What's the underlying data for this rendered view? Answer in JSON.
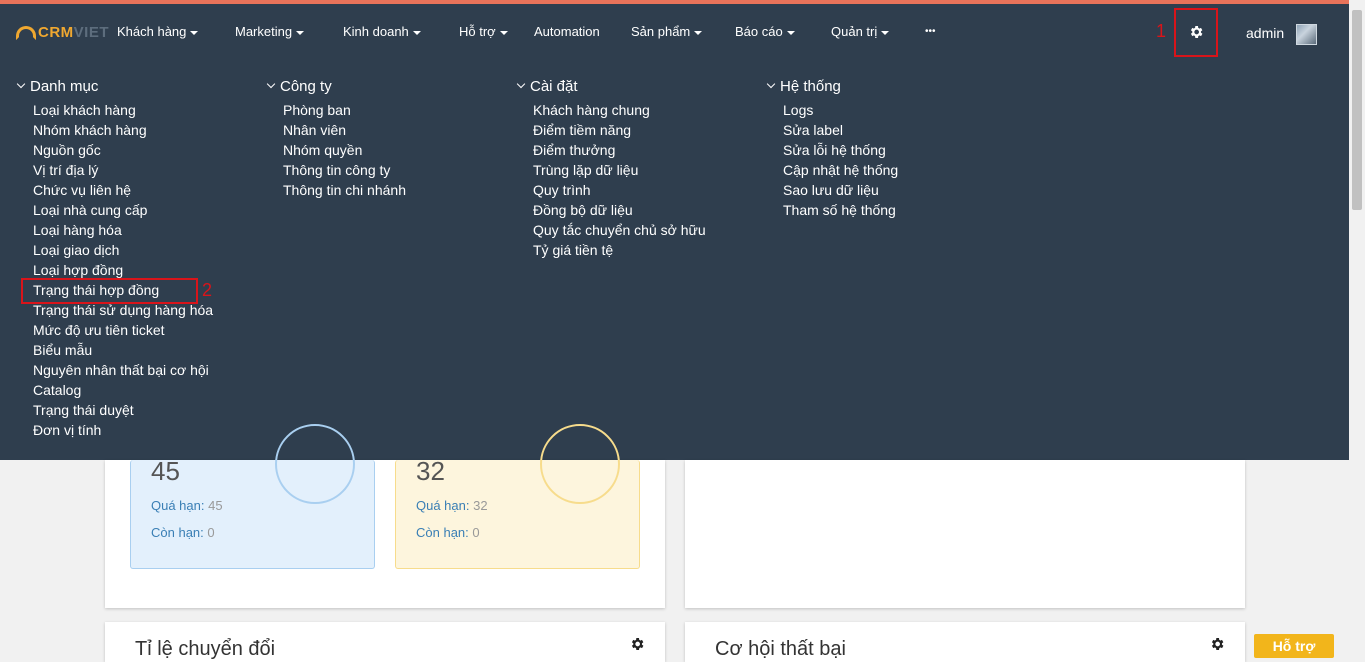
{
  "app": {
    "logo_main": "CRM",
    "logo_sub": "VIET"
  },
  "nav": {
    "items": [
      {
        "label": "Khách hàng",
        "caret": true
      },
      {
        "label": "Marketing",
        "caret": true
      },
      {
        "label": "Kinh doanh",
        "caret": true
      },
      {
        "label": "Hỗ trợ",
        "caret": true
      },
      {
        "label": "Automation",
        "caret": false
      },
      {
        "label": "Sản phẩm",
        "caret": true
      },
      {
        "label": "Báo cáo",
        "caret": true
      },
      {
        "label": "Quản trị",
        "caret": true
      },
      {
        "label": "•••",
        "caret": false
      }
    ],
    "settings_icon": "gear-icon",
    "user": "admin"
  },
  "annotations": {
    "step1": "1",
    "step2": "2"
  },
  "menu": {
    "columns": [
      {
        "title": "Danh mục",
        "items": [
          "Loại khách hàng",
          "Nhóm khách hàng",
          "Nguồn gốc",
          "Vị trí địa lý",
          "Chức vụ liên hệ",
          "Loại nhà cung cấp",
          "Loại hàng hóa",
          "Loại giao dịch",
          "Loại hợp đồng",
          "Trạng thái hợp đồng",
          "Trạng thái sử dụng hàng hóa",
          "Mức độ ưu tiên ticket",
          "Biểu mẫu",
          "Nguyên nhân thất bại cơ hội",
          "Catalog",
          "Trạng thái duyệt",
          "Đơn vị tính"
        ]
      },
      {
        "title": "Công ty",
        "items": [
          "Phòng ban",
          "Nhân viên",
          "Nhóm quyền",
          "Thông tin công ty",
          "Thông tin chi nhánh"
        ]
      },
      {
        "title": "Cài đặt",
        "items": [
          "Khách hàng chung",
          "Điểm tiềm năng",
          "Điểm thưởng",
          "Trùng lặp dữ liệu",
          "Quy trình",
          "Đồng bộ dữ liệu",
          "Quy tắc chuyển chủ sở hữu",
          "Tỷ giá tiền tệ"
        ]
      },
      {
        "title": "Hệ thống",
        "items": [
          "Logs",
          "Sửa label",
          "Sửa lỗi hệ thống",
          "Cập nhật hệ thống",
          "Sao lưu dữ liệu",
          "Tham số hệ thống"
        ]
      }
    ]
  },
  "dashboard": {
    "stat1": {
      "number": "45",
      "overdue_label": "Quá hạn:",
      "overdue_value": "45",
      "remaining_label": "Còn hạn:",
      "remaining_value": "0"
    },
    "stat2": {
      "number": "32",
      "overdue_label": "Quá hạn:",
      "overdue_value": "32",
      "remaining_label": "Còn hạn:",
      "remaining_value": "0"
    },
    "card_conversion_title": "Tỉ lệ chuyển đổi",
    "card_lost_title": "Cơ hội thất bại"
  },
  "support_button": "Hỗ trợ",
  "colors": {
    "navbar": "#2f3e4e",
    "accent": "#f0a830",
    "annotation": "#d9141a",
    "support": "#f2b51b"
  }
}
